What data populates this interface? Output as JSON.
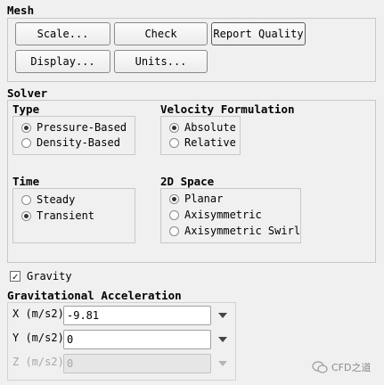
{
  "mesh": {
    "title": "Mesh",
    "buttons": [
      "Scale...",
      "Check",
      "Report Quality",
      "Display...",
      "Units..."
    ]
  },
  "solver": {
    "title": "Solver",
    "type": {
      "title": "Type",
      "options": [
        "Pressure-Based",
        "Density-Based"
      ],
      "selected": "Pressure-Based"
    },
    "velocity": {
      "title": "Velocity Formulation",
      "options": [
        "Absolute",
        "Relative"
      ],
      "selected": "Absolute"
    },
    "time": {
      "title": "Time",
      "options": [
        "Steady",
        "Transient"
      ],
      "selected": "Transient"
    },
    "space2d": {
      "title": "2D Space",
      "options": [
        "Planar",
        "Axisymmetric",
        "Axisymmetric Swirl"
      ],
      "selected": "Planar"
    }
  },
  "gravity": {
    "label": "Gravity",
    "checked": true
  },
  "grav_accel": {
    "title": "Gravitational Acceleration",
    "fields": [
      {
        "label": "X (m/s2)",
        "value": "-9.81",
        "enabled": true
      },
      {
        "label": "Y (m/s2)",
        "value": "0",
        "enabled": true
      },
      {
        "label": "Z (m/s2)",
        "value": "0",
        "enabled": false
      }
    ]
  },
  "watermark": {
    "text": "CFD之道"
  }
}
